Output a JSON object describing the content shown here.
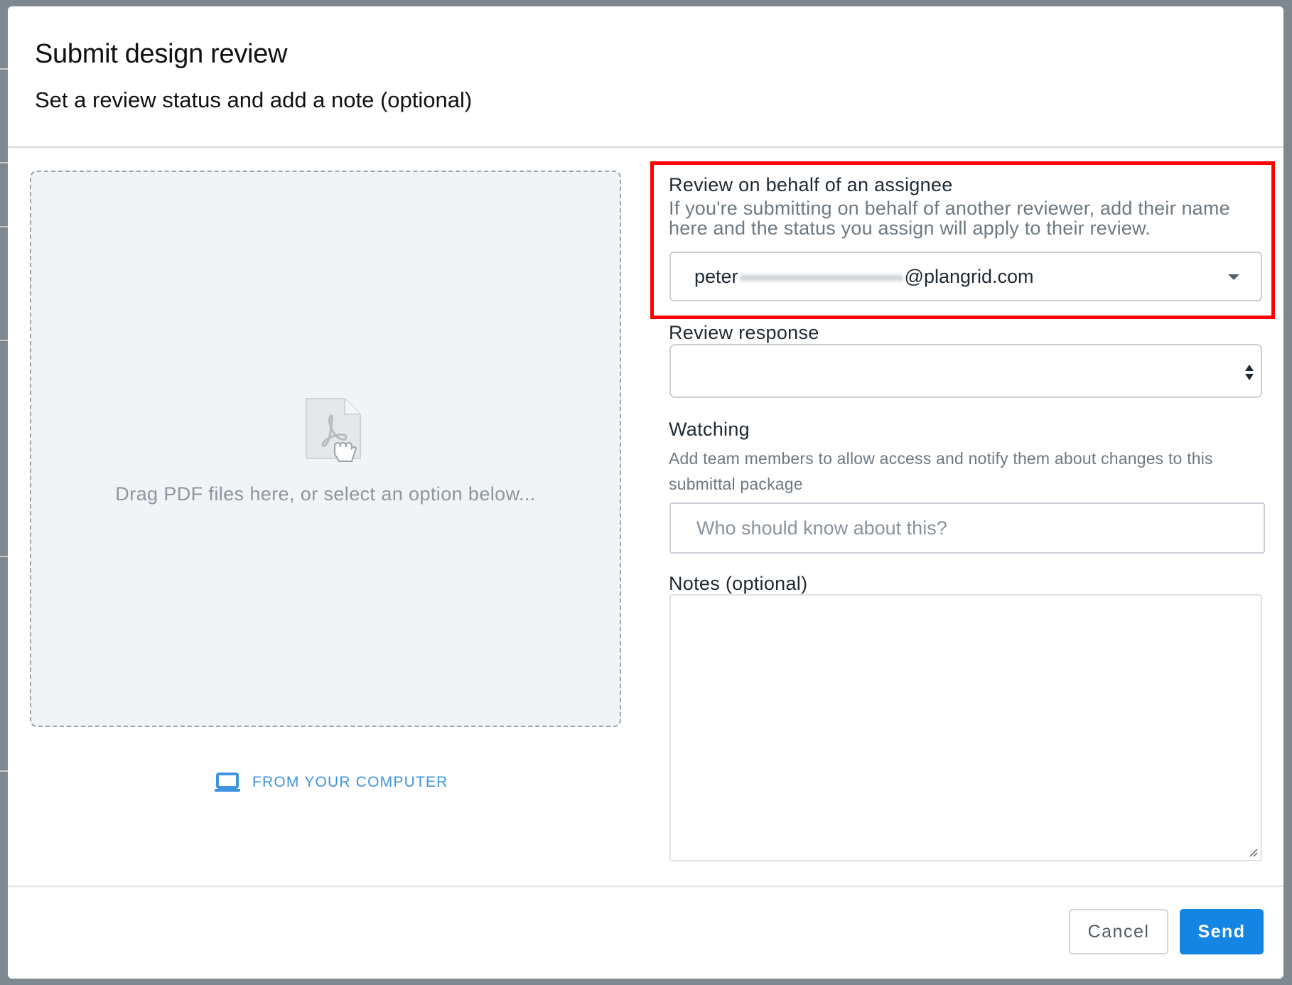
{
  "modal": {
    "title": "Submit design review",
    "subtitle": "Set a review status and add a note (optional)"
  },
  "upload": {
    "icon": "pdf-drag-icon",
    "drop_text": "Drag PDF files here, or select an option below...",
    "from_computer_icon": "laptop-icon",
    "from_computer_label": "FROM YOUR COMPUTER"
  },
  "assignee": {
    "label": "Review on behalf of an assignee",
    "help": "If you're submitting on behalf of another reviewer, add their name here and the status you assign will apply to their review.",
    "value_prefix": "peter",
    "value_suffix": "@plangrid.com",
    "highlight_color": "#ff0000"
  },
  "review_response": {
    "label": "Review response",
    "value": ""
  },
  "watching": {
    "label": "Watching",
    "help": "Add team members to allow access and notify them about changes to this submittal package",
    "placeholder": "Who should know about this?"
  },
  "notes": {
    "label": "Notes (optional)",
    "value": ""
  },
  "footer": {
    "cancel_label": "Cancel",
    "send_label": "Send"
  },
  "colors": {
    "accent": "#1585e4",
    "link": "#3f94e0"
  }
}
